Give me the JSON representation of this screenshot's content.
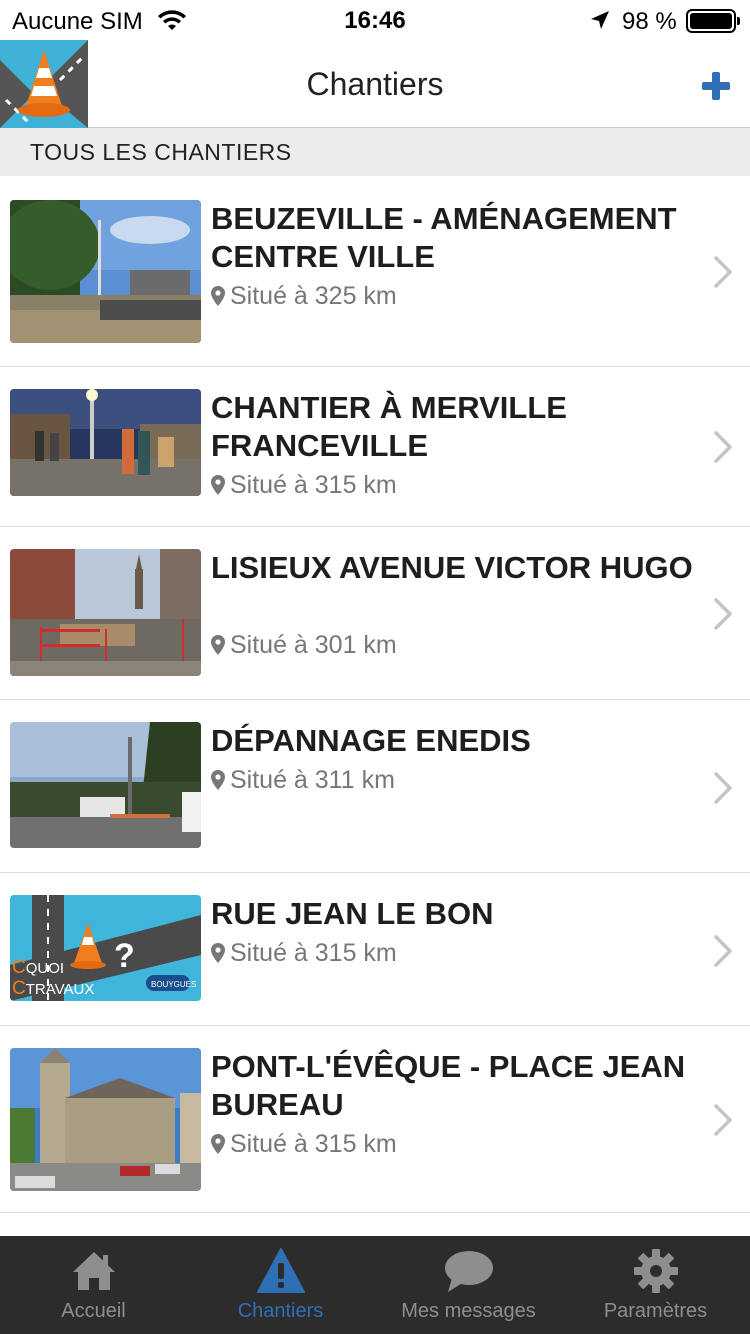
{
  "status_bar": {
    "carrier": "Aucune SIM",
    "time": "16:46",
    "battery": "98 %"
  },
  "nav": {
    "title": "Chantiers",
    "add_icon": "plus-icon",
    "logo_icon": "traffic-cone-logo"
  },
  "section": {
    "label": "TOUS LES CHANTIERS"
  },
  "sites": [
    {
      "title": "BEUZEVILLE - AMÉNAGEMENT CENTRE VILLE",
      "distance": "Situé à 325 km"
    },
    {
      "title": "CHANTIER À MERVILLE FRANCEVILLE",
      "distance": "Situé à 315 km"
    },
    {
      "title": "LISIEUX AVENUE VICTOR HUGO",
      "distance": "Situé à 301 km"
    },
    {
      "title": "DÉPANNAGE ENEDIS",
      "distance": "Situé à 311 km"
    },
    {
      "title": "RUE JEAN LE BON",
      "distance": "Situé à 315 km"
    },
    {
      "title": "PONT-L'ÉVÊQUE - PLACE JEAN BUREAU",
      "distance": "Situé à 315 km"
    }
  ],
  "placeholder_logo": {
    "line1": "QUOI",
    "line2": "TRAVAUX",
    "brand": "BOUYGUES"
  },
  "tabs": [
    {
      "label": "Accueil",
      "icon": "home-icon"
    },
    {
      "label": "Chantiers",
      "icon": "warning-icon"
    },
    {
      "label": "Mes messages",
      "icon": "chat-bubble-icon"
    },
    {
      "label": "Paramètres",
      "icon": "gear-icon"
    }
  ],
  "colors": {
    "accent": "#2f6fb6",
    "tab_bar": "#2c2c2c",
    "section_bg": "#ececec"
  }
}
